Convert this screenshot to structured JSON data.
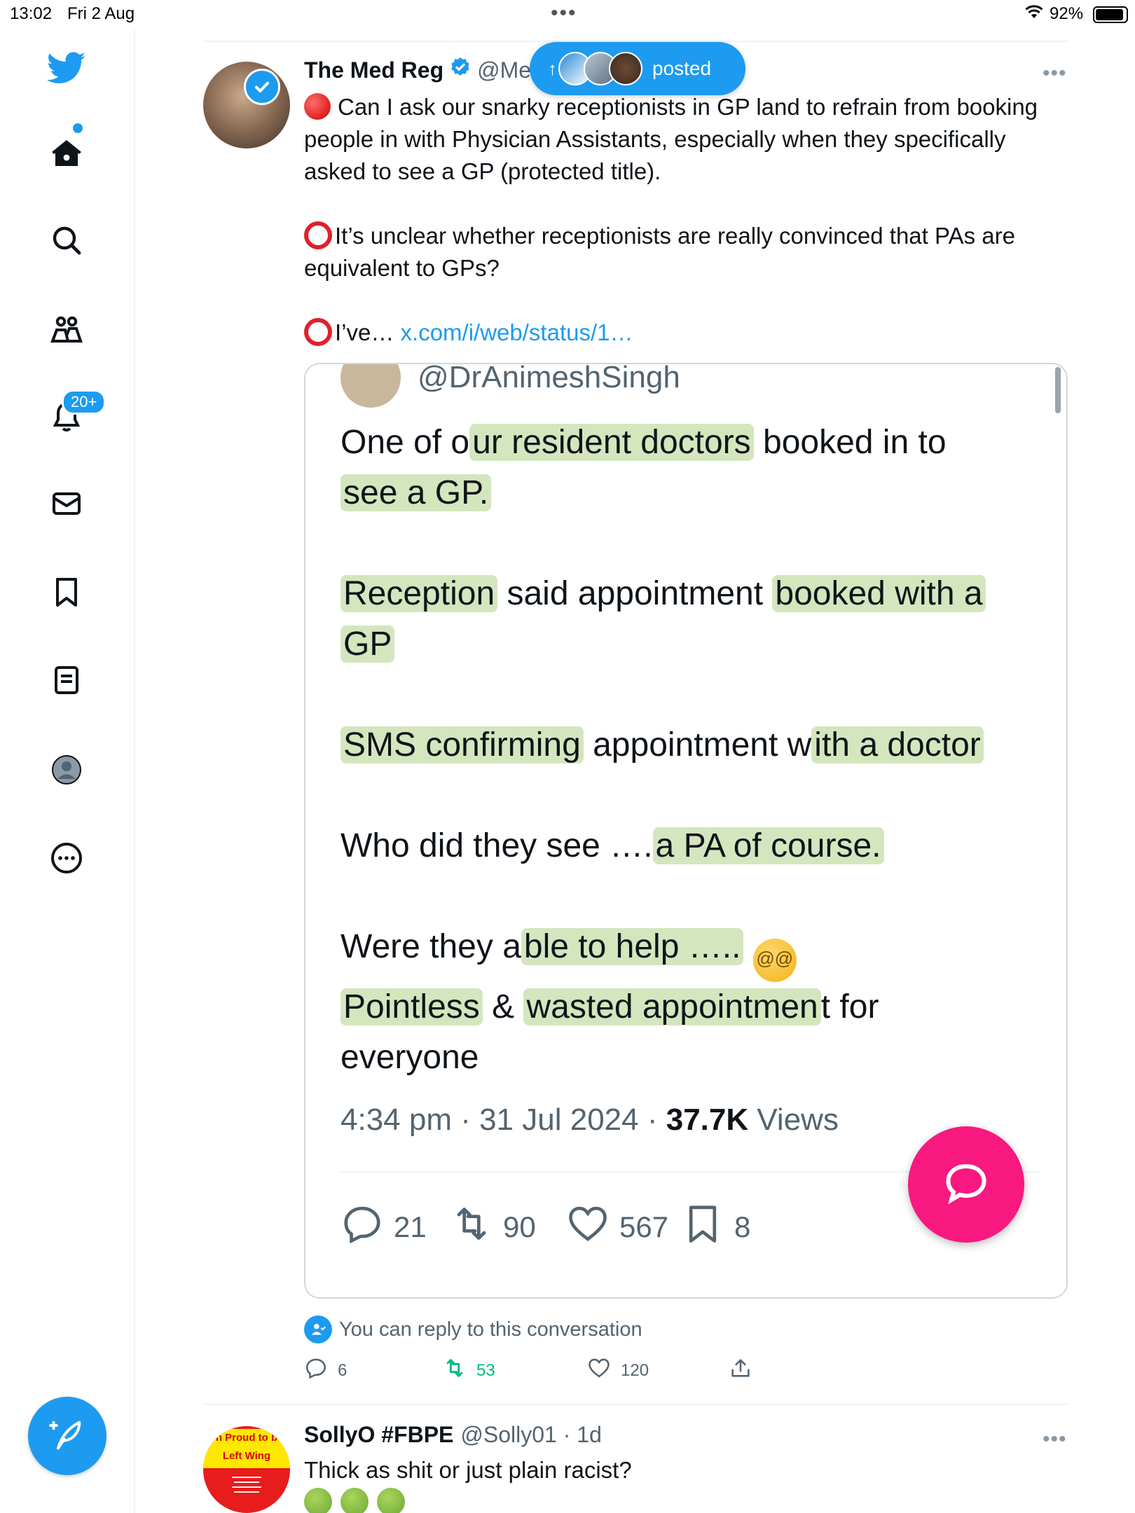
{
  "status_bar": {
    "time": "13:02",
    "date": "Fri 2 Aug",
    "multitask_dots": "•••",
    "battery_percent": "92%",
    "battery_level": 0.92
  },
  "sidebar": {
    "items": [
      {
        "name": "home",
        "icon": "home-icon"
      },
      {
        "name": "search",
        "icon": "search-icon"
      },
      {
        "name": "communities",
        "icon": "communities-icon"
      },
      {
        "name": "notifications",
        "icon": "bell-icon",
        "badge": "20+"
      },
      {
        "name": "messages",
        "icon": "mail-icon"
      },
      {
        "name": "bookmarks",
        "icon": "bookmark-icon"
      },
      {
        "name": "lists",
        "icon": "list-icon"
      },
      {
        "name": "profile",
        "icon": "profile-icon"
      },
      {
        "name": "more",
        "icon": "more-icon"
      }
    ],
    "compose_icon": "compose-feather-icon",
    "accent_color": "#1d9bf0"
  },
  "posted_pill": {
    "arrow": "↑",
    "label": "posted"
  },
  "tweet": {
    "name": "The Med Reg",
    "handle": "@Me",
    "more": "•••",
    "para1": "Can I ask our snarky receptionists in GP land to refrain from booking people in with Physician Assistants, especially when they specifically asked to see a GP (protected title).",
    "para2": "It’s unclear whether receptionists are really convinced that PAs are equivalent to GPs?",
    "para3_text": "I’ve…",
    "para3_link": "x.com/i/web/status/1…",
    "reply_note": "You can reply to this conversation",
    "replies": "6",
    "retweets": "53",
    "likes": "120",
    "retweet_color": "#00ba7c"
  },
  "embedded": {
    "handle": "@DrAnimeshSingh",
    "l1_a": "One of o",
    "l1_b": "ur resident doctors",
    "l1_c": " booked in to",
    "l1_d": "see a GP.",
    "l2_a": "Reception",
    "l2_b": " said appointment ",
    "l2_c": "booked with a",
    "l2_d": "GP",
    "l3_a": "SMS confirming",
    "l3_b": " appointment w",
    "l3_c": "ith a doctor",
    "l4_a": "Who did they see ….",
    "l4_b": "a PA of course.",
    "l5_a": "Were they a",
    "l5_b": "ble to help …..",
    "l5_emoji": "@@",
    "l6_a": "Pointless",
    "l6_b": " & ",
    "l6_c": "wasted appointmen",
    "l6_d": "t for",
    "l7": "everyone",
    "time": "4:34 pm · 31 Jul 2024 · ",
    "views_count": "37.7K",
    "views_label": " Views",
    "replies": "21",
    "retweets": "90",
    "likes": "567",
    "bookmarks": "8",
    "highlight_color": "#a0c86e"
  },
  "fab": {
    "icon": "new-message-bubble-icon",
    "color": "#f91880"
  },
  "tweet2": {
    "avatar_banner_1": "n Proud to b",
    "avatar_banner_2": "Left Wing",
    "name": "SollyO #FBPE",
    "handle": "@Solly01 · 1d",
    "text": "Thick as shit or just plain racist?",
    "more": "•••"
  }
}
